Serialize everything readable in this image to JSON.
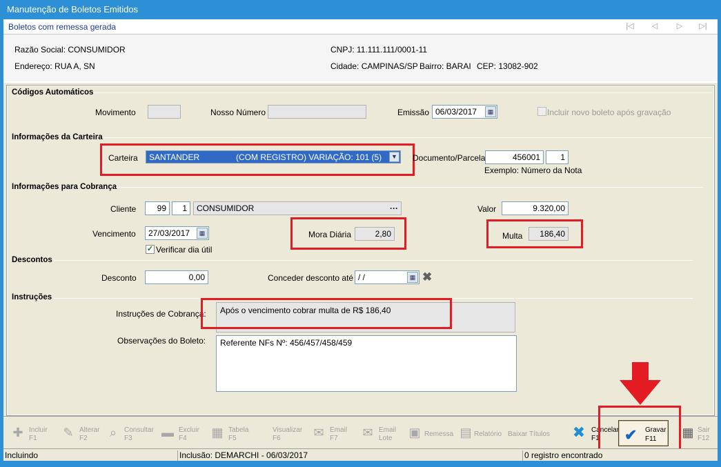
{
  "window": {
    "title": "Manutenção de Boletos Emitidos"
  },
  "subbar": {
    "text": "Boletos com remessa gerada",
    "nav": [
      "|◁",
      "◁",
      "▷",
      "▷|"
    ]
  },
  "header": {
    "razao_social": "Razão Social: CONSUMIDOR",
    "endereco": "Endereço: RUA A, SN",
    "cnpj": "CNPJ: 11.111.111/0001-11",
    "cidade": "Cidade: CAMPINAS/SP",
    "bairro": "Bairro: BARAI",
    "cep": "CEP: 13082-902"
  },
  "codigos": {
    "section": "Códigos Automáticos",
    "movimento_label": "Movimento",
    "movimento_value": "",
    "nosso_numero_label": "Nosso Número",
    "nosso_numero_value": "",
    "emissao_label": "Emissão",
    "emissao_value": "06/03/2017",
    "incluir_novo_label": "Incluir novo boleto após gravação"
  },
  "carteira": {
    "section": "Informações da Carteira",
    "carteira_label": "Carteira",
    "carteira_bank": "SANTANDER",
    "carteira_desc": "(COM REGISTRO) VARIAÇÃO: 101 (5)",
    "documento_label": "Documento/Parcela",
    "documento_value": "456001",
    "parcela_value": "1",
    "exemplo": "Exemplo: Número da Nota"
  },
  "cobranca": {
    "section": "Informações para Cobrança",
    "cliente_label": "Cliente",
    "cliente_codigo": "99",
    "cliente_loja": "1",
    "cliente_nome": "CONSUMIDOR",
    "cliente_more": "···",
    "valor_label": "Valor",
    "valor_value": "9.320,00",
    "vencimento_label": "Vencimento",
    "vencimento_value": "27/03/2017",
    "mora_label": "Mora Diária",
    "mora_value": "2,80",
    "multa_label": "Multa",
    "multa_value": "186,40",
    "verificar_label": "Verificar dia útil",
    "verificar_checked": "✓"
  },
  "descontos": {
    "section": "Descontos",
    "desconto_label": "Desconto",
    "desconto_value": "0,00",
    "conceder_label": "Conceder desconto até",
    "conceder_value": " /  /"
  },
  "instrucoes": {
    "section": "Instruções",
    "instrucoes_label": "Instruções de Cobrança:",
    "instrucoes_value": "Após o vencimento cobrar multa de R$ 186,40",
    "observacoes_label": "Observações do Boleto:",
    "observacoes_value": "Referente NFs Nº: 456/457/458/459"
  },
  "toolbar": {
    "incluir": "Incluir",
    "incluir_key": "F1",
    "alterar": "Alterar",
    "alterar_key": "F2",
    "consultar": "Consultar",
    "consultar_key": "F3",
    "excluir": "Excluir",
    "excluir_key": "F4",
    "tabela": "Tabela",
    "tabela_key": "F5",
    "visualizar": "Visualizar",
    "visualizar_key": "F6",
    "email": "Email",
    "email_key": "F7",
    "email_lote": "Email",
    "email_lote_sub": "Lote",
    "remessa": "Remessa",
    "relatorio": "Relatório",
    "baixar": "Baixar Títulos",
    "cancelar": "Cancelar",
    "cancelar_key": "F1",
    "gravar": "Gravar",
    "gravar_key": "F11",
    "sair": "Sair",
    "sair_key": "F12"
  },
  "status": {
    "mode": "Incluindo",
    "inclusao": "Inclusão: DEMARCHI - 06/03/2017",
    "registros": "0 registro encontrado"
  },
  "colors": {
    "accent": "#2d8fd6",
    "highlight_red": "#e31b23",
    "selection": "#316ac5"
  }
}
